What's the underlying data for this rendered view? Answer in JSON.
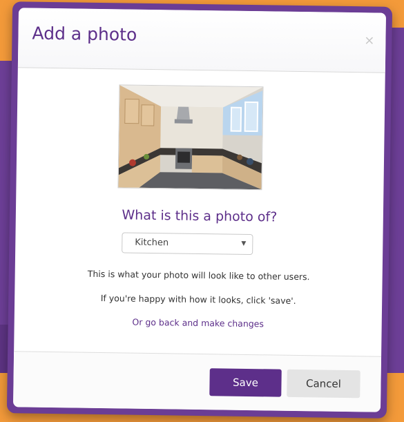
{
  "dialog": {
    "title": "Add a photo",
    "close_symbol": "×",
    "photo_icon": "kitchen-photo",
    "question": "What is this a photo of?",
    "room_type": {
      "selected": "Kitchen",
      "arrow_symbol": "▼"
    },
    "info_line_1": "This is what your photo will look like to other users.",
    "info_line_2": "If you're happy with how it looks, click 'save'.",
    "back_link": "Or go back and make changes",
    "save_label": "Save",
    "cancel_label": "Cancel"
  },
  "colors": {
    "brand_purple": "#5d2f8a",
    "background_orange": "#f39a3a",
    "cancel_grey": "#e4e4e4"
  }
}
